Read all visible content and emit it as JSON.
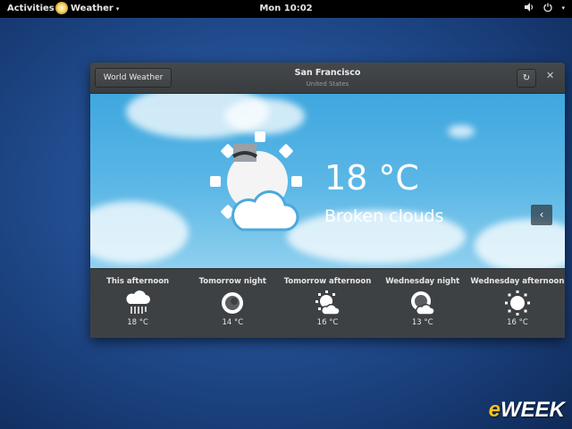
{
  "topbar": {
    "activities": "Activities",
    "app_name": "Weather",
    "clock": "Mon 10:02",
    "icons": [
      "volume-icon",
      "power-icon"
    ]
  },
  "window": {
    "world_button": "World Weather",
    "city": "San Francisco",
    "country": "United States",
    "current": {
      "temperature": "18 °C",
      "condition": "Broken clouds",
      "icon": "sun-behind-cloud-night-icon"
    },
    "forecast": [
      {
        "label": "This afternoon",
        "temp": "18 °C",
        "icon": "rain-icon"
      },
      {
        "label": "Tomorrow night",
        "temp": "14 °C",
        "icon": "clear-night-icon"
      },
      {
        "label": "Tomorrow afternoon",
        "temp": "16 °C",
        "icon": "partly-cloudy-icon"
      },
      {
        "label": "Wednesday night",
        "temp": "13 °C",
        "icon": "partly-cloudy-night-icon"
      },
      {
        "label": "Wednesday afternoon",
        "temp": "16 °C",
        "icon": "sunny-icon"
      }
    ]
  },
  "watermark": "eWEEK",
  "colors": {
    "topbar": "#000000",
    "window": "#3b3e40",
    "sky": "#4eb0e2",
    "logo_accent": "#f7c21a"
  }
}
